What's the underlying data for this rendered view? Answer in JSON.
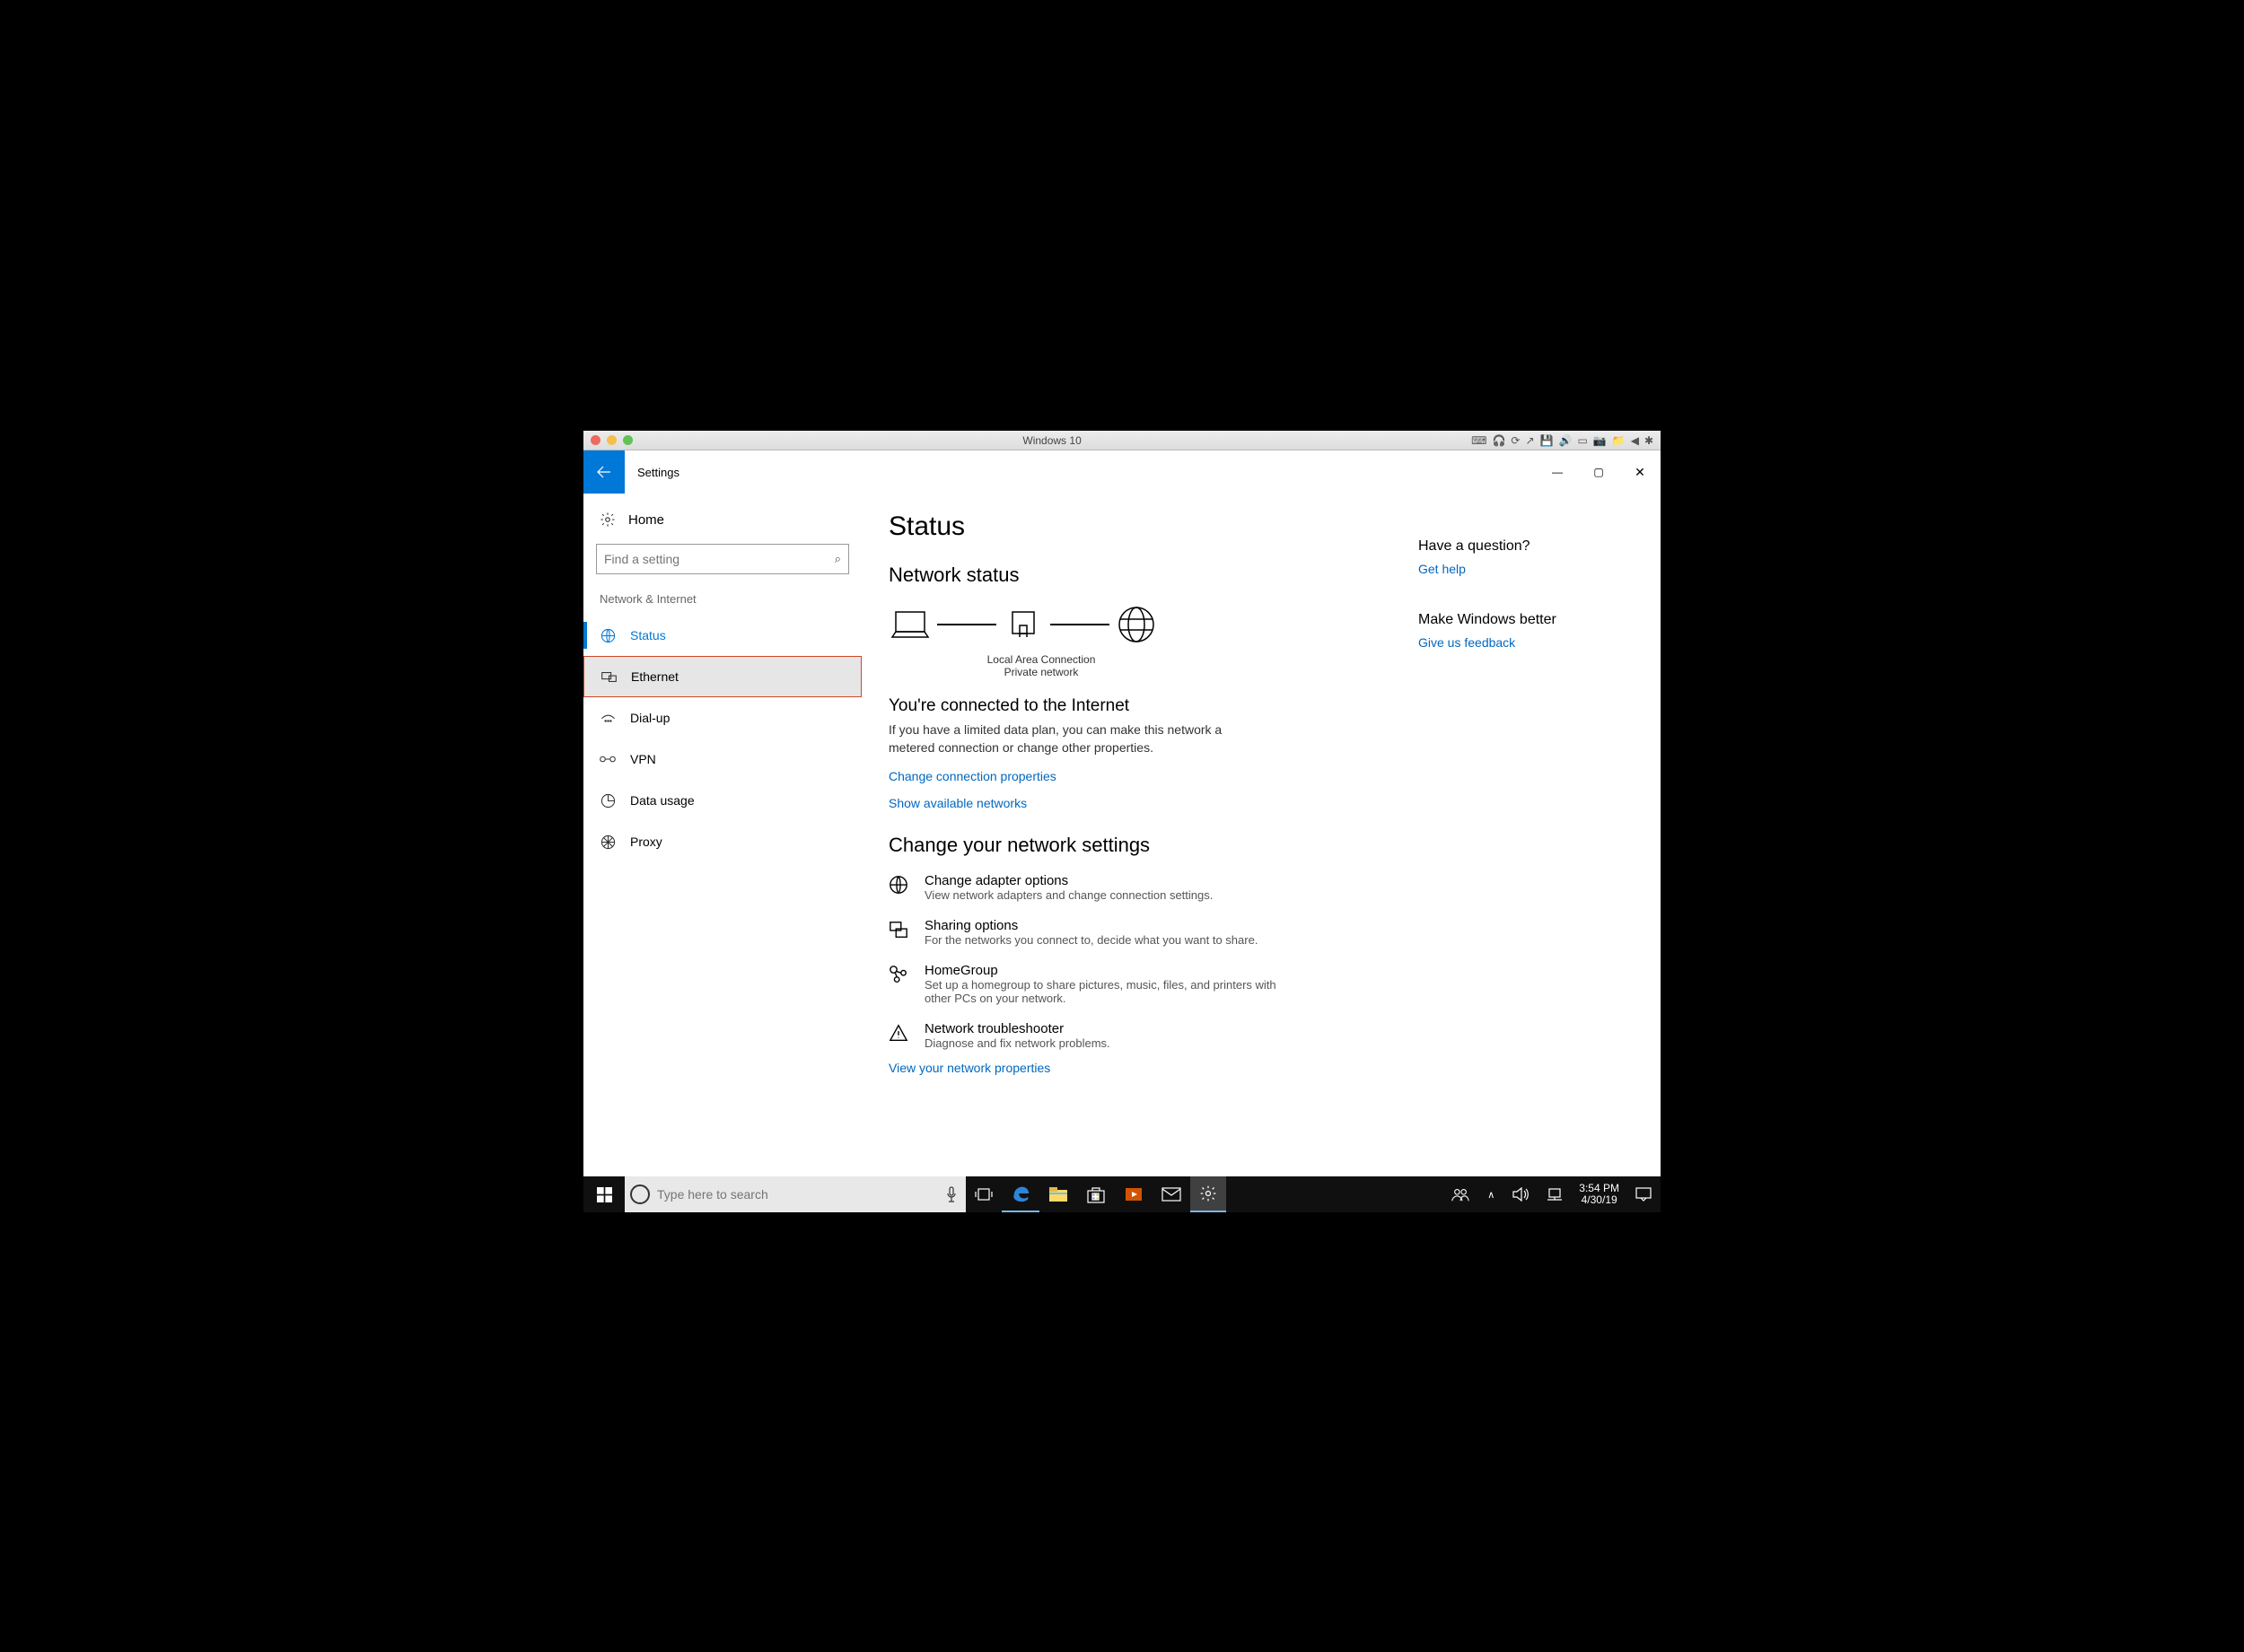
{
  "mac": {
    "title": "Windows 10",
    "menu_icons": [
      "⌨",
      "🎧",
      "⟳",
      "↗",
      "💾",
      "🔊",
      "▭",
      "📷",
      "📁",
      "◀",
      "✱"
    ]
  },
  "app": {
    "title": "Settings",
    "window_controls": {
      "min": "—",
      "max": "▢",
      "close": "✕"
    }
  },
  "sidebar": {
    "home": "Home",
    "search_placeholder": "Find a setting",
    "group": "Network & Internet",
    "items": [
      {
        "label": "Status",
        "icon": "status",
        "state": "active"
      },
      {
        "label": "Ethernet",
        "icon": "ethernet",
        "state": "highlight"
      },
      {
        "label": "Dial-up",
        "icon": "dialup",
        "state": ""
      },
      {
        "label": "VPN",
        "icon": "vpn",
        "state": ""
      },
      {
        "label": "Data usage",
        "icon": "datausage",
        "state": ""
      },
      {
        "label": "Proxy",
        "icon": "proxy",
        "state": ""
      }
    ]
  },
  "main": {
    "title": "Status",
    "section1": "Network status",
    "diagram": {
      "cap1": "Local Area Connection",
      "cap2": "Private network"
    },
    "connected_title": "You're connected to the Internet",
    "connected_desc": "If you have a limited data plan, you can make this network a metered connection or change other properties.",
    "link_props": "Change connection properties",
    "link_avail": "Show available networks",
    "section2": "Change your network settings",
    "options": [
      {
        "title": "Change adapter options",
        "desc": "View network adapters and change connection settings."
      },
      {
        "title": "Sharing options",
        "desc": "For the networks you connect to, decide what you want to share."
      },
      {
        "title": "HomeGroup",
        "desc": "Set up a homegroup to share pictures, music, files, and printers with other PCs on your network."
      },
      {
        "title": "Network troubleshooter",
        "desc": "Diagnose and fix network problems."
      }
    ],
    "link_viewprops": "View your network properties"
  },
  "right": {
    "q1": "Have a question?",
    "l1": "Get help",
    "q2": "Make Windows better",
    "l2": "Give us feedback"
  },
  "taskbar": {
    "search_placeholder": "Type here to search",
    "time": "3:54 PM",
    "date": "4/30/19"
  }
}
